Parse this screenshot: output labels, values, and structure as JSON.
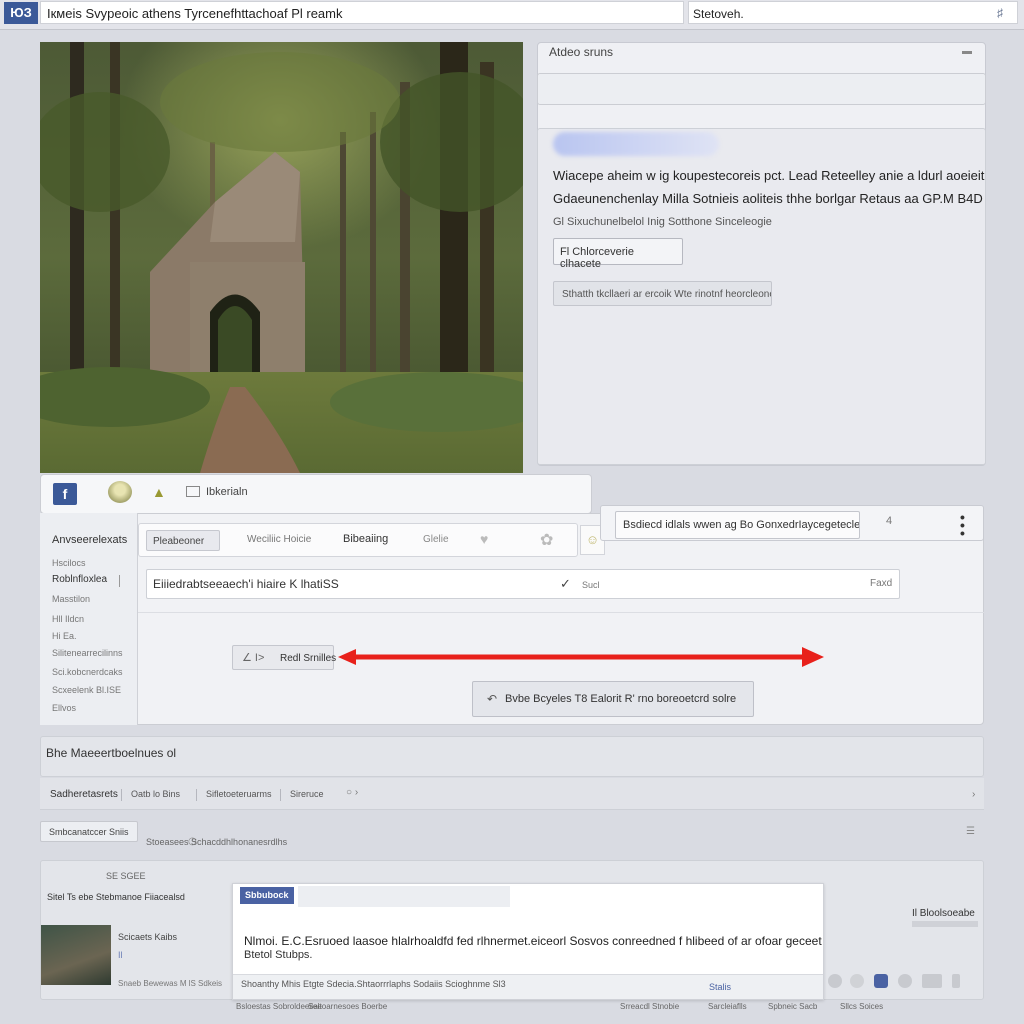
{
  "topbar": {
    "logo": "ЮЗ",
    "title": "Iкмeis Svypeoic athens  Tyrcenefhttachoaf Pl reamk",
    "search_value": "Stetoveh."
  },
  "right_panel": {
    "title": "Atdeo sruns",
    "desc_1": "Wiacepe aheim w ig  koupestecoreis pct.  Lead  Reteelley anie a ldurl aoeieit",
    "desc_2": "Gdaeunenchenlay  Milla  Sotnieis aoliteis  thhe borlgar Retaus aa  GP.M  B4D",
    "desc_3": "Gl Sixuchunelbelol  Inig  Sotthone Sinceleogie",
    "button_option": "Fl Chlorceverie  clhacete",
    "button_long": "Sthatth tkcllaeri ar ercoik Wte rinotnf heorcleoneaene"
  },
  "toolbar": {
    "label": "Ibkerialn"
  },
  "sidebar": {
    "items": [
      "Anvseerelexats",
      "Hscilocs",
      "Roblnfloxlea",
      "Masstilon",
      "Hll Ildcn",
      "Hi Ea.",
      "Silitenearrecilinns",
      "Sci.kobcnerdcaks",
      "Scxeelenk Bl.ISE",
      "Ellvos"
    ]
  },
  "composer": {
    "tabs": [
      "Pleabeoner",
      "Weciliic   Hoicie",
      "Bibeaiing",
      "Glelie"
    ],
    "edit_value": "Eiiiedrabtseeaech'i hiaire  K lhatiSS",
    "edit_mid": "Sucl",
    "edit_right": "Faxd",
    "reply_label": "Redl Srnilles",
    "post_label": "Bvbe Bcyeles T8 Ealorit R' rno  boreoetcrd solre"
  },
  "info_strip": {
    "text": "Bsdiecd  idlals  wwen  ag  Bo GonxedrIaycegetecle",
    "num": "4"
  },
  "lower": {
    "title": "Bhe  Maeeertboelnues  ol",
    "filters": [
      "Sadheretasrets",
      "Oatb  lo Bins",
      "Sifletoeteruarms",
      "Sireruce"
    ],
    "sort_label": "Smbcanatccer Sniis",
    "sort_text": "Stoeasees  Schacddhlhonanesrdlhs"
  },
  "feed": {
    "head": "SE  SGEE",
    "left_title": "Sitel  Ts ebe Stebmanoe Fiiacealsd",
    "thumb_label": "Scicaets  Kaibs",
    "thumb_mark": "Il",
    "thumb_meta": "Snaeb  Bewewas  M lS  Sdkeis",
    "popup_header": "Sbbubock",
    "popup_msg": "Nlmoi. E.C.Esruoed  laasoe  hlalrhoaldfd  fed  rlhnermet.eiceorl  Sosvos  conreedned  f  hlibeed  of  ar  ofoar  geceet",
    "popup_msg2": "Btetol  Stubps.",
    "popup_foot": "Shoanthy  Mhis  Etgte  Sdecia.Shtaorrrlaphs  Sodaiis  Scioghnme  Sl3",
    "popup_foot_link": "Stalis",
    "side_note": "Il Bloolsoeabe"
  },
  "bottom": {
    "items": [
      "Bsloestas  Sobroldeeiiee",
      "Saltoarnesoes  Boerbe",
      "Srreacdl Stnobie",
      "Sarcleiaflls",
      "Spbneic  Sacb",
      "Sllcs Soices"
    ]
  },
  "colors": {
    "brand": "#3b5998",
    "arrow": "#e8211b",
    "background": "#d9dbe2"
  }
}
